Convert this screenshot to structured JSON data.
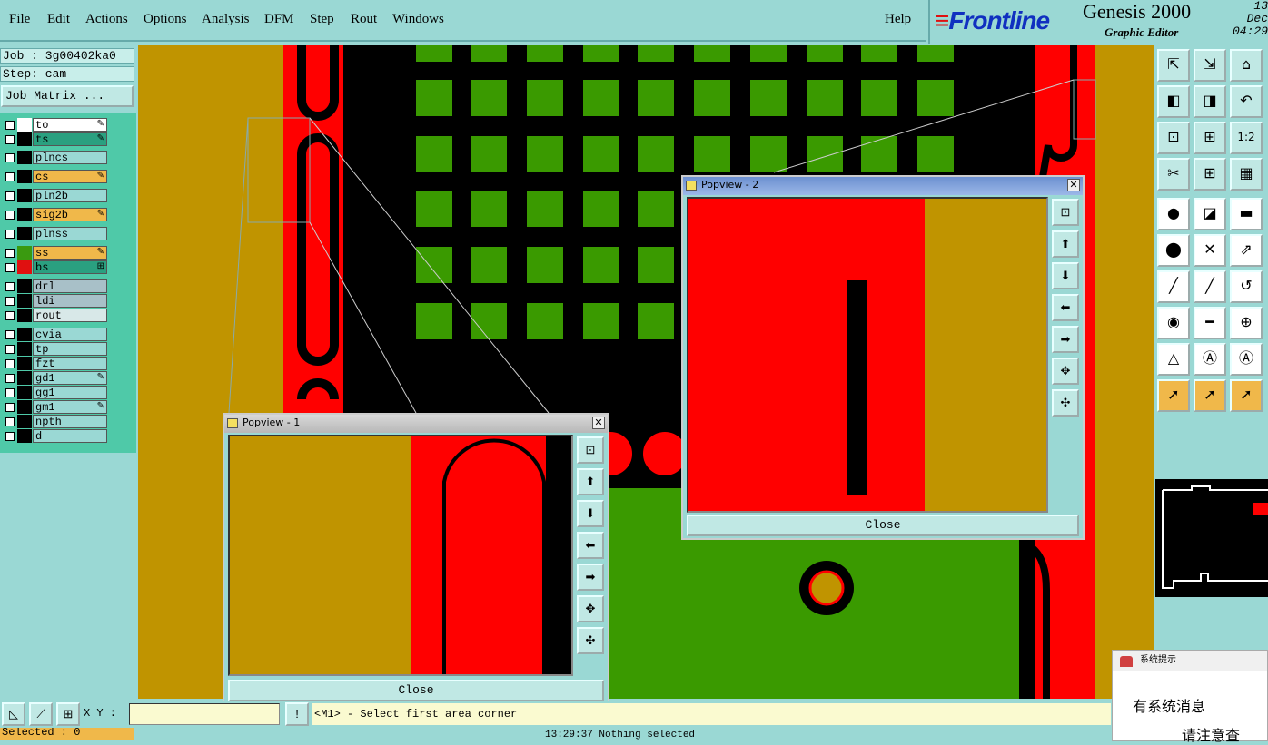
{
  "menu": {
    "items": [
      "File",
      "Edit",
      "Actions",
      "Options",
      "Analysis",
      "DFM",
      "Step",
      "Rout",
      "Windows"
    ],
    "help": "Help"
  },
  "branding": {
    "logo": "Frontline",
    "product": "Genesis 2000",
    "subtitle": "Graphic Editor",
    "date": "13 Dec",
    "time": "04:29"
  },
  "job": {
    "job_label": "Job : 3g00402ka0",
    "step_label": "Step: cam",
    "matrix_button": "Job Matrix ..."
  },
  "layers": [
    {
      "name": "to",
      "color": "#ffffff",
      "bg": "#ffffff",
      "mark": "✎"
    },
    {
      "name": "ts",
      "color": "#000000",
      "bg": "#2aa080",
      "mark": "✎"
    },
    {
      "name": "plncs",
      "color": "#000000",
      "bg": "#9ad8d4",
      "mark": ""
    },
    {
      "name": "cs",
      "color": "#000000",
      "bg": "#f0b84a",
      "mark": "✎"
    },
    {
      "name": "pln2b",
      "color": "#000000",
      "bg": "#9ad8d4",
      "mark": ""
    },
    {
      "name": "sig2b",
      "color": "#000000",
      "bg": "#f0b84a",
      "mark": "✎"
    },
    {
      "name": "plnss",
      "color": "#000000",
      "bg": "#9ad8d4",
      "mark": ""
    },
    {
      "name": "ss",
      "color": "#3a9a10",
      "bg": "#f0b84a",
      "mark": "✎"
    },
    {
      "name": "bs",
      "color": "#e01010",
      "bg": "#2aa080",
      "mark": "⊞"
    },
    {
      "name": "drl",
      "color": "#000000",
      "bg": "#a8c0c8",
      "mark": ""
    },
    {
      "name": "ldi",
      "color": "#000000",
      "bg": "#a8c0c8",
      "mark": ""
    },
    {
      "name": "rout",
      "color": "#000000",
      "bg": "#d8e8e8",
      "mark": ""
    },
    {
      "name": "cvia",
      "color": "#000000",
      "bg": "#9ad8d4",
      "mark": ""
    },
    {
      "name": "tp",
      "color": "#000000",
      "bg": "#9ad8d4",
      "mark": ""
    },
    {
      "name": "fzt",
      "color": "#000000",
      "bg": "#9ad8d4",
      "mark": ""
    },
    {
      "name": "gd1",
      "color": "#000000",
      "bg": "#9ad8d4",
      "mark": "✎"
    },
    {
      "name": "gg1",
      "color": "#000000",
      "bg": "#9ad8d4",
      "mark": ""
    },
    {
      "name": "gm1",
      "color": "#000000",
      "bg": "#9ad8d4",
      "mark": "✎"
    },
    {
      "name": "npth",
      "color": "#000000",
      "bg": "#9ad8d4",
      "mark": ""
    },
    {
      "name": "d",
      "color": "#000000",
      "bg": "#9ad8d4",
      "mark": ""
    }
  ],
  "selected": "Selected : 0",
  "popview1": {
    "title": "Popview - 1",
    "close": "Close"
  },
  "popview2": {
    "title": "Popview - 2",
    "close": "Close"
  },
  "toolbar_icons": [
    "zoom-home-icon",
    "zoom-in-icon",
    "zoom-fit-icon",
    "pan-left-icon",
    "pan-right-icon",
    "undo-zoom-icon",
    "fit-all-icon",
    "fit-profile-icon",
    "scale-1-2-icon",
    "snap-icon",
    "grid-icon",
    "layers-icon",
    "add-pad-icon",
    "add-line-icon",
    "measure-icon",
    "connect-icon",
    "delete-icon",
    "move-icon",
    "line-icon",
    "line2-icon",
    "arc-icon",
    "pad-icon",
    "cut-icon",
    "transform-icon",
    "triangle-icon",
    "triangle-a-icon",
    "triangle-box-icon",
    "select-icon",
    "select-box-icon",
    "select-round-icon"
  ],
  "toolbar_glyphs": [
    "⇱",
    "⇲",
    "⌂",
    "◧",
    "◨",
    "↶",
    "⊡",
    "⊞",
    "1:2",
    "✂",
    "⊞",
    "▦",
    "●",
    "◪",
    "▬",
    "⬤",
    "✕",
    "⇗",
    "╱",
    "╱",
    "↺",
    "◉",
    "━",
    "⊕",
    "△",
    "Ⓐ",
    "Ⓐ",
    "➚",
    "➚",
    "➚"
  ],
  "bottom": {
    "xy_label": "X Y :",
    "xy_value": "",
    "status": "<M1> - Select first area corner",
    "footer": "13:29:37 Nothing selected"
  },
  "notification": {
    "title": "系统提示",
    "line1": "有系统消息",
    "line2": "请注意查"
  },
  "colors": {
    "red": "#ff0000",
    "green": "#3a9a00",
    "gold": "#c09400",
    "black": "#000000",
    "panel": "#9ad8d4"
  }
}
